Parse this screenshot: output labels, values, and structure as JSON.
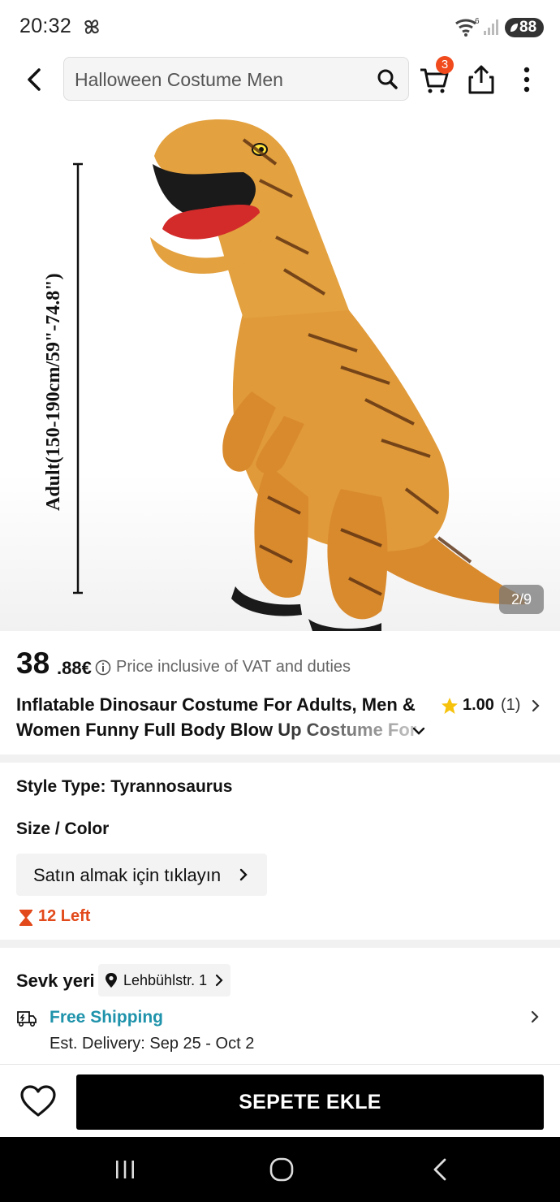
{
  "status_bar": {
    "time": "20:32",
    "battery": "88",
    "wifi_label": "6"
  },
  "header": {
    "search_value": "Halloween Costume Men",
    "cart_count": "3"
  },
  "gallery": {
    "image_caption": "Adult(150-190cm/59\"-74.8\")",
    "counter": "2/9"
  },
  "product": {
    "price_int": "38",
    "price_dec": ".88€",
    "price_note": "Price inclusive of VAT and duties",
    "title_line1": "Inflatable Dinosaur Costume For Adults, Men &",
    "title_line2": "Women Funny Full Body Blow Up Costume For",
    "rating_value": "1.00",
    "rating_count": "(1)",
    "style_type": "Style Type: Tyrannosaurus",
    "size_color": "Size / Color",
    "buy_prompt": "Satın almak için tıklayın",
    "stock_left": "12 Left"
  },
  "shipping": {
    "ship_from_label": "Sevk yeri",
    "address": "Lehbühlstr. 1",
    "free_shipping": "Free Shipping",
    "est_delivery": "Est. Delivery: Sep 25 - Oct 2"
  },
  "bottom_bar": {
    "add_to_cart": "SEPETE EKLE"
  },
  "colors": {
    "accent_orange": "#e24a1b",
    "badge_red": "#f04a1d",
    "shipping_teal": "#1f93ab",
    "star_yellow": "#f6c20c"
  }
}
